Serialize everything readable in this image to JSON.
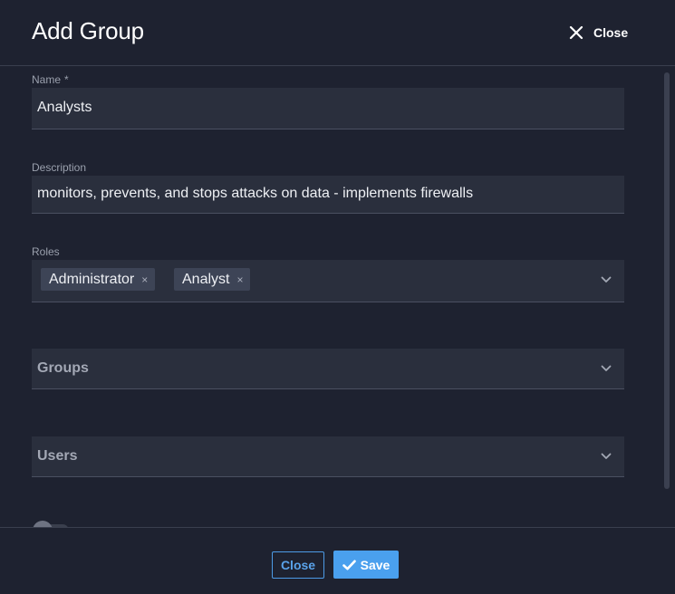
{
  "dialog": {
    "title": "Add Group",
    "close_label": "Close"
  },
  "form": {
    "name": {
      "label": "Name",
      "required_marker": "*",
      "value": "Analysts"
    },
    "description": {
      "label": "Description",
      "value": "monitors, prevents, and stops attacks on data - implements firewalls"
    },
    "roles": {
      "label": "Roles",
      "selected": [
        "Administrator",
        "Analyst"
      ],
      "remove_glyph": "×"
    },
    "groups": {
      "placeholder": "Groups"
    },
    "users": {
      "placeholder": "Users"
    }
  },
  "footer": {
    "close_label": "Close",
    "save_label": "Save"
  },
  "colors": {
    "background": "#1e2230",
    "field": "#2a2f3d",
    "accent": "#4aa0ee",
    "tag": "#3d4456"
  },
  "icons": {
    "header_close": "close-icon",
    "dropdown": "chevron-down-icon",
    "save": "check-icon"
  }
}
